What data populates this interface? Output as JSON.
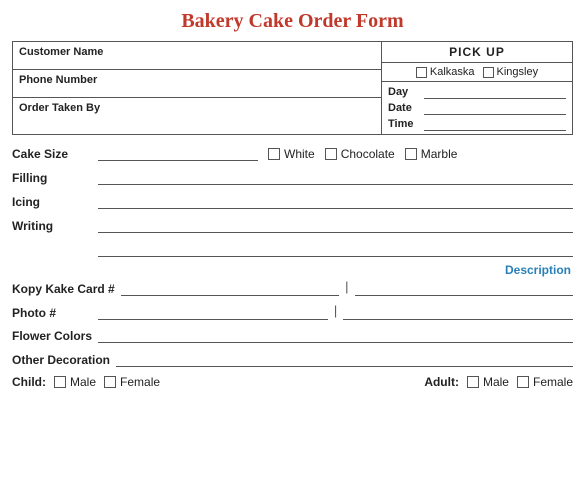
{
  "title": "Bakery Cake Order Form",
  "top_section": {
    "customer_name_label": "Customer Name",
    "phone_number_label": "Phone Number",
    "order_taken_label": "Order Taken By",
    "pickup_header": "PICK UP",
    "location1": "Kalkaska",
    "location2": "Kingsley",
    "day_label": "Day",
    "date_label": "Date",
    "time_label": "Time"
  },
  "form": {
    "cake_size_label": "Cake Size",
    "white_label": "White",
    "chocolate_label": "Chocolate",
    "marble_label": "Marble",
    "filling_label": "Filling",
    "icing_label": "Icing",
    "writing_label": "Writing",
    "description_header": "Description",
    "kopy_kake_label": "Kopy Kake Card #",
    "photo_label": "Photo #",
    "flower_colors_label": "Flower Colors",
    "other_decoration_label": "Other Decoration",
    "child_label": "Child:",
    "male_label": "Male",
    "female_label": "Female",
    "adult_label": "Adult:",
    "adult_male_label": "Male",
    "adult_female_label": "Female"
  }
}
